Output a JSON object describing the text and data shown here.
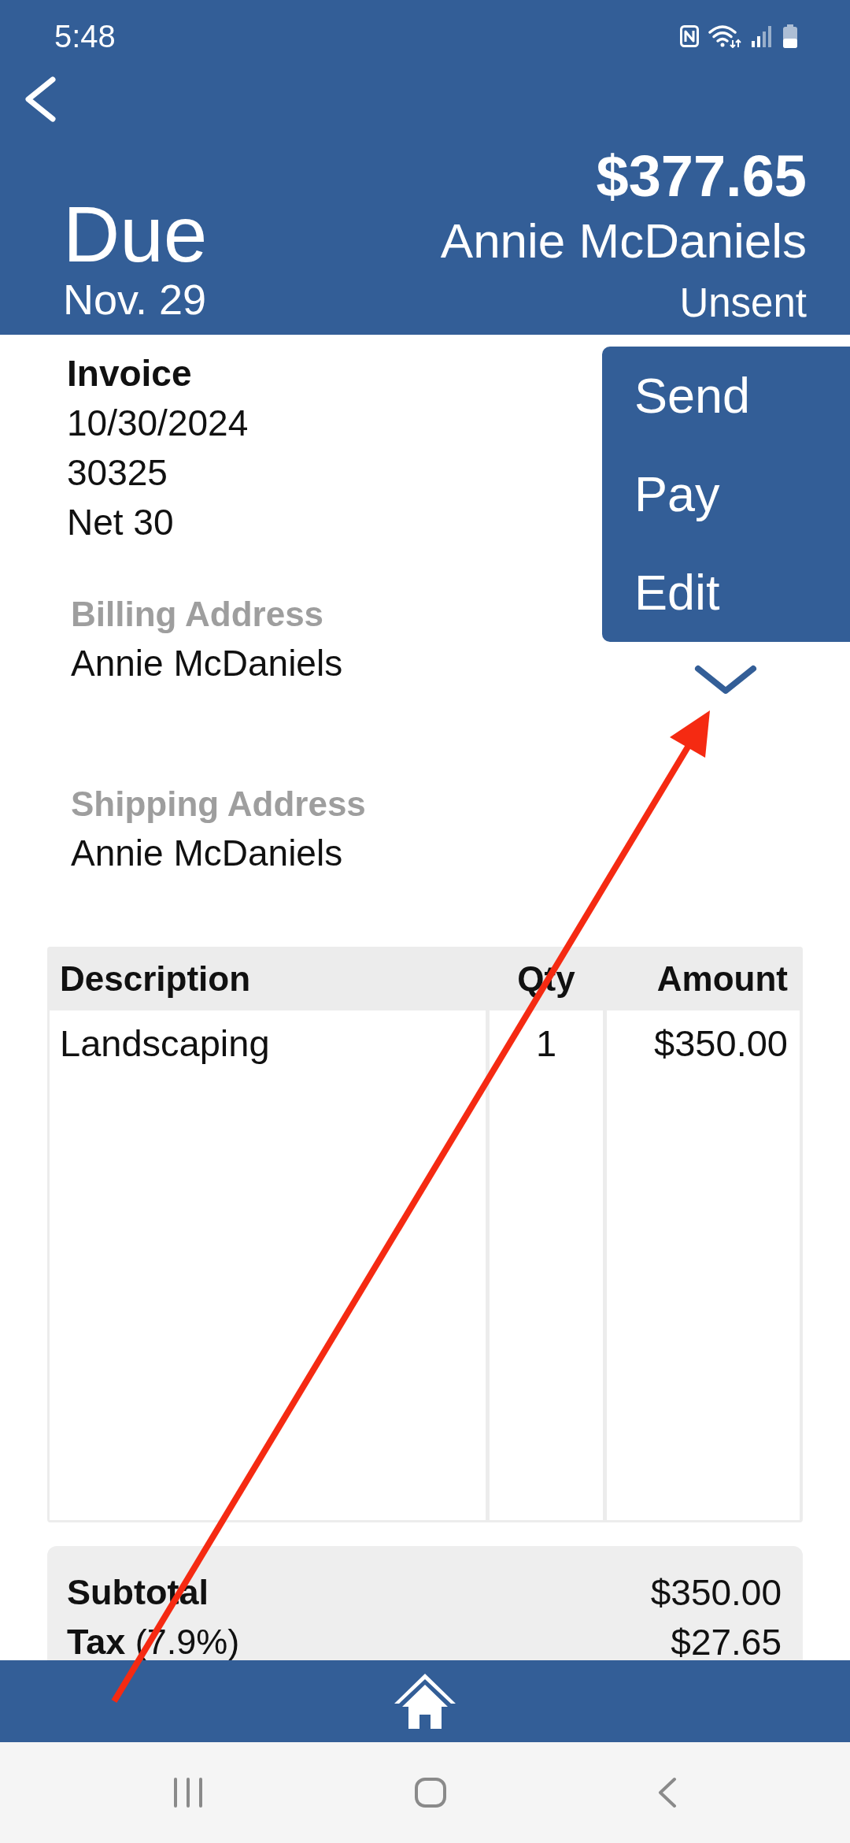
{
  "status_bar": {
    "time": "5:48"
  },
  "header": {
    "due_label": "Due",
    "due_date": "Nov. 29",
    "amount": "$377.65",
    "customer": "Annie McDaniels",
    "status": "Unsent"
  },
  "invoice": {
    "title": "Invoice",
    "lines": [
      "10/30/2024",
      "30325",
      "Net 30"
    ]
  },
  "addresses": [
    {
      "label": "Billing Address",
      "name": "Annie McDaniels"
    },
    {
      "label": "Shipping Address",
      "name": "Annie McDaniels"
    }
  ],
  "action_menu": {
    "items": [
      "Send",
      "Pay",
      "Edit"
    ]
  },
  "table": {
    "columns": [
      "Description",
      "Qty",
      "Amount"
    ],
    "rows": [
      {
        "description": "Landscaping",
        "qty": "1",
        "amount": "$350.00"
      }
    ]
  },
  "totals": [
    {
      "label": "Subtotal",
      "value": "$350.00"
    },
    {
      "label": "Tax",
      "note": "(7.9%)",
      "value": "$27.65"
    }
  ]
}
